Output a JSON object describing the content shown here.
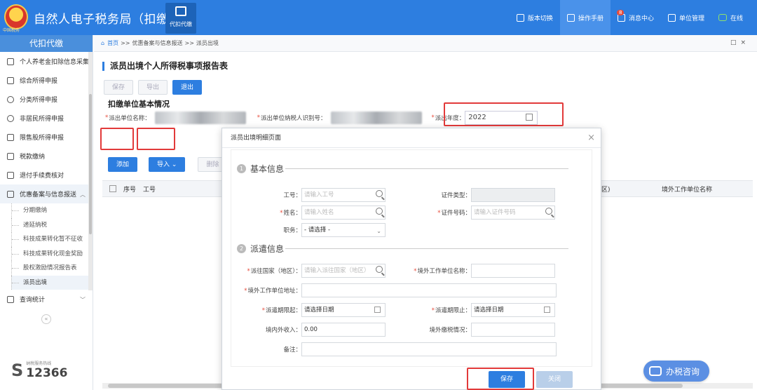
{
  "app": {
    "emblem_text": "中国税务",
    "title": "自然人电子税务局（扣缴端）",
    "module_label": "代扣代缴"
  },
  "topnav": {
    "items": [
      {
        "label": "版本切换",
        "icon": "switch-icon"
      },
      {
        "label": "操作手册",
        "icon": "manual-icon"
      },
      {
        "label": "消息中心",
        "icon": "message-icon",
        "badge": "8"
      },
      {
        "label": "单位管理",
        "icon": "building-icon"
      },
      {
        "label": "在线",
        "icon": "online-icon"
      }
    ]
  },
  "sidebar": {
    "header": "代扣代缴",
    "items": [
      {
        "label": "个人养老金扣除信息采集",
        "icon": "pension-icon"
      },
      {
        "label": "综合所得申报",
        "icon": "layers-icon"
      },
      {
        "label": "分类所得申报",
        "icon": "pie-icon"
      },
      {
        "label": "非居民所得申报",
        "icon": "person-icon"
      },
      {
        "label": "限售股所得申报",
        "icon": "bar-chart-icon"
      },
      {
        "label": "税款缴纳",
        "icon": "wallet-icon"
      },
      {
        "label": "退付手续费核对",
        "icon": "checklist-icon"
      },
      {
        "label": "优惠备案与信息报送",
        "icon": "document-icon"
      }
    ],
    "subitems": [
      "分期缴纳",
      "递延纳税",
      "科技成果转化暂不征收",
      "科技成果转化现金奖励",
      "股权激励情况报告表",
      "派员出境"
    ],
    "stats_item": "查询统计",
    "hotline_label": "纳税服务热线",
    "hotline_number": "12366"
  },
  "breadcrumb": {
    "home": "首页",
    "sep": ">>",
    "level1": "优惠备案与信息报送",
    "level2": "派员出境"
  },
  "form": {
    "title": "派员出境个人所得税事项报告表",
    "buttons": {
      "save": "保存",
      "export": "导出",
      "exit": "退出"
    },
    "section": "扣缴单位基本情况",
    "unit_name_label": "派出单位名称：",
    "unit_taxid_label": "派出单位纳税人识别号：",
    "year_label": "派出年度：",
    "year_value": "2022",
    "list_buttons": {
      "add": "添加",
      "import": "导入",
      "delete": "删除"
    },
    "columns": [
      "序号",
      "工号"
    ],
    "right_columns": [
      "区)",
      "境外工作单位名称"
    ]
  },
  "consult": {
    "label": "办税咨询"
  },
  "modal": {
    "title": "派员出境明细页面",
    "group1": {
      "num": "1",
      "title": "基本信息"
    },
    "group2": {
      "num": "2",
      "title": "派遣信息"
    },
    "fields": {
      "worker_id_label": "工号：",
      "worker_id_placeholder": "请输入工号",
      "cert_type_label": "证件类型：",
      "name_label": "姓名：",
      "name_placeholder": "请输入姓名",
      "cert_no_label": "证件号码：",
      "cert_no_placeholder": "请输入证件号码",
      "position_label": "职务：",
      "position_value": "- 请选择 -",
      "country_label": "派往国家（地区）：",
      "country_placeholder": "请输入派往国家（地区）",
      "foreign_unit_label": "境外工作单位名称：",
      "foreign_addr_label": "境外工作单位地址：",
      "start_label": "派遣期限起：",
      "start_value": "请选择日期",
      "end_label": "派遣期限止：",
      "end_value": "请选择日期",
      "income_label": "境内外收入：",
      "income_value": "0.00",
      "foreign_tax_label": "境外缴税情况：",
      "remark_label": "备注："
    },
    "buttons": {
      "save": "保存",
      "close": "关闭"
    }
  },
  "colors": {
    "accent": "#2d7ee0",
    "highlight": "#e23a3a"
  }
}
